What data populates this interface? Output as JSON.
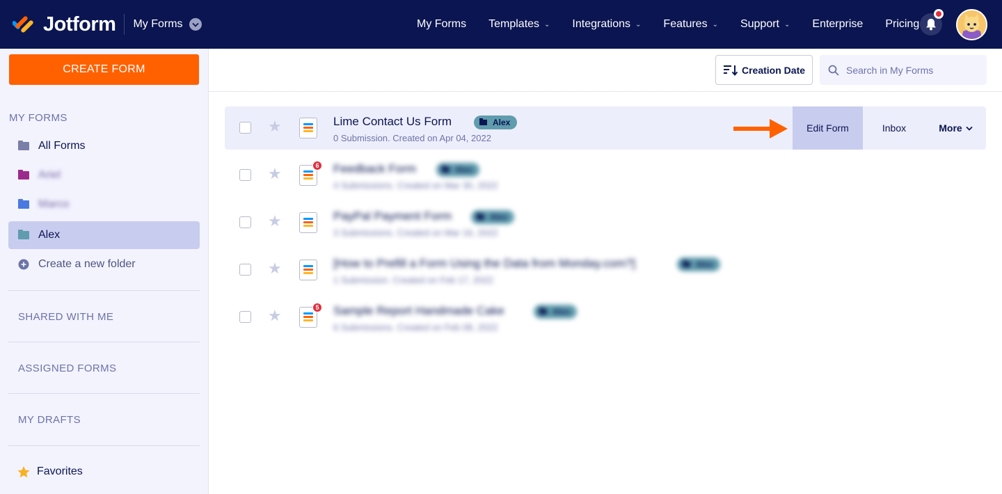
{
  "header": {
    "brand": "Jotform",
    "switcher_label": "My Forms",
    "nav": [
      {
        "label": "My Forms",
        "caret": false
      },
      {
        "label": "Templates",
        "caret": true
      },
      {
        "label": "Integrations",
        "caret": true
      },
      {
        "label": "Features",
        "caret": true
      },
      {
        "label": "Support",
        "caret": true
      },
      {
        "label": "Enterprise",
        "caret": false
      },
      {
        "label": "Pricing",
        "caret": false
      }
    ],
    "caret_glyph": "⌄",
    "icons": [
      "bell-icon",
      "avatar"
    ]
  },
  "sidebar": {
    "create_label": "CREATE FORM",
    "my_forms_heading": "MY FORMS",
    "items": [
      {
        "label": "All Forms",
        "color": "#7a7fa8"
      },
      {
        "label": "Ariel",
        "color": "#9c2a8c"
      },
      {
        "label": "Marco",
        "color": "#4a79e0"
      },
      {
        "label": "Alex",
        "color": "#5f9cad"
      }
    ],
    "new_folder_label": "Create a new folder",
    "shared_heading": "SHARED WITH ME",
    "assigned_heading": "ASSIGNED FORMS",
    "drafts_heading": "MY DRAFTS",
    "favorites_label": "Favorites"
  },
  "toolbar": {
    "sort_label": "Creation Date",
    "search_placeholder": "Search in My Forms"
  },
  "forms": [
    {
      "title": "Lime Contact Us Form",
      "subtitle": "0 Submission. Created on Apr 04, 2022",
      "folder": "Alex",
      "unread": ""
    },
    {
      "title": "Feedback Form",
      "subtitle": "4 Submissions. Created on Mar 30, 2022",
      "folder": "Alex",
      "unread": "6"
    },
    {
      "title": "PayPal Payment Form",
      "subtitle": "3 Submissions. Created on Mar 16, 2022",
      "folder": "Alex",
      "unread": ""
    },
    {
      "title": "[How to Prefill a Form Using the Data from Monday.com?]",
      "subtitle": "1 Submission. Created on Feb 17, 2022",
      "folder": "Alex",
      "unread": ""
    },
    {
      "title": "Sample Report Handmade Cake",
      "subtitle": "6 Submissions. Created on Feb 08, 2022",
      "folder": "Alex",
      "unread": "5"
    }
  ],
  "row_actions": {
    "edit_label": "Edit Form",
    "inbox_label": "Inbox",
    "more_label": "More"
  },
  "colors": {
    "navbar": "#0a1551",
    "create_button": "#ff6100",
    "accent_arrow": "#ff6100",
    "active_folder": "#c8ccef"
  }
}
